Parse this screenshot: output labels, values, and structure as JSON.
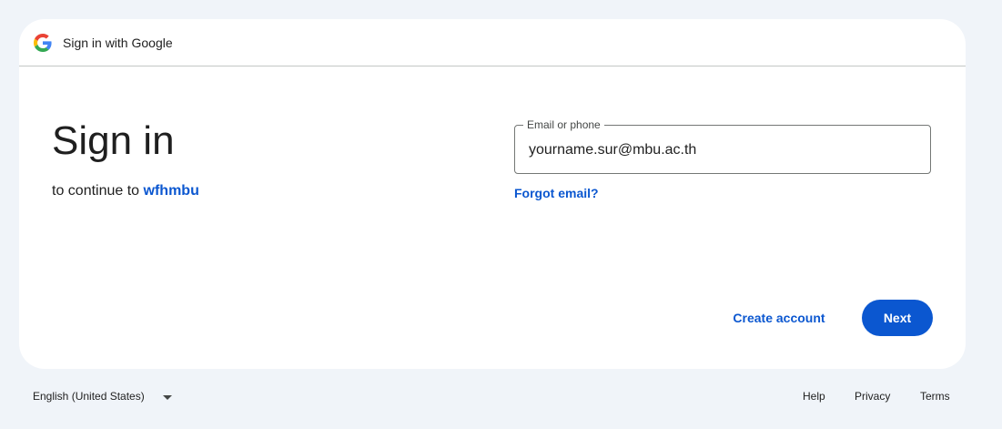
{
  "header": {
    "title": "Sign in with Google",
    "logo_icon": "google-g-icon"
  },
  "main": {
    "headline": "Sign in",
    "subline_prefix": "to continue to",
    "app_name": "wfhmbu"
  },
  "email_field": {
    "label": "Email or phone",
    "value": "yourname.sur@mbu.ac.th"
  },
  "forgot_email": "Forgot email?",
  "actions": {
    "create_account": "Create account",
    "next": "Next"
  },
  "footer": {
    "language": "English (United States)",
    "language_icon": "chevron-down-icon",
    "help": "Help",
    "privacy": "Privacy",
    "terms": "Terms"
  },
  "colors": {
    "accent": "#0b57d0",
    "background": "#f0f4f9",
    "card": "#ffffff"
  }
}
